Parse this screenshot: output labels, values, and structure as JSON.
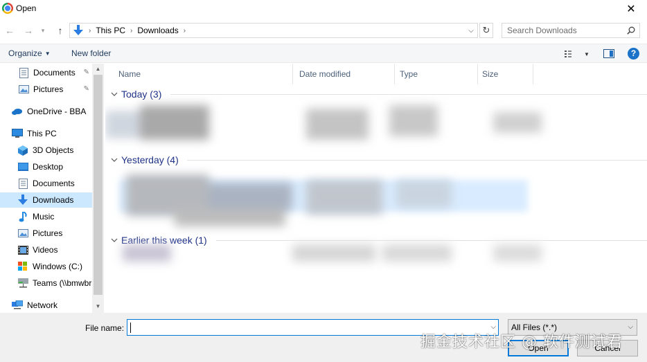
{
  "window": {
    "title": "Open",
    "close_glyph": "✕"
  },
  "nav": {
    "back_glyph": "←",
    "forward_glyph": "→",
    "recent_glyph": "▾",
    "up_glyph": "↑",
    "refresh_glyph": "↻"
  },
  "address": {
    "crumbs": [
      "This PC",
      "Downloads"
    ],
    "separator": "›",
    "dropdown_glyph": "⌵"
  },
  "search": {
    "placeholder": "Search Downloads",
    "value": ""
  },
  "toolbar": {
    "organize_label": "Organize",
    "new_folder_label": "New folder",
    "help_label": "?"
  },
  "navigation_pane": {
    "items": [
      {
        "label": "Documents",
        "icon": "documents-icon",
        "pinned": true
      },
      {
        "label": "Pictures",
        "icon": "pictures-icon",
        "pinned": true
      },
      {
        "label": "OneDrive - BBA",
        "icon": "onedrive-icon"
      },
      {
        "label": "This PC",
        "icon": "this-pc-icon"
      },
      {
        "label": "3D Objects",
        "icon": "3d-objects-icon"
      },
      {
        "label": "Desktop",
        "icon": "desktop-icon"
      },
      {
        "label": "Documents",
        "icon": "documents-icon"
      },
      {
        "label": "Downloads",
        "icon": "downloads-icon",
        "selected": true
      },
      {
        "label": "Music",
        "icon": "music-icon"
      },
      {
        "label": "Pictures",
        "icon": "pictures-icon"
      },
      {
        "label": "Videos",
        "icon": "videos-icon"
      },
      {
        "label": "Windows (C:)",
        "icon": "drive-icon"
      },
      {
        "label": "Teams (\\\\bmwbr",
        "icon": "network-drive-icon"
      },
      {
        "label": "Network",
        "icon": "network-icon"
      }
    ],
    "pin_glyph": "📌"
  },
  "file_list": {
    "columns": [
      "Name",
      "Date modified",
      "Type",
      "Size"
    ],
    "groups": [
      {
        "label": "Today (3)"
      },
      {
        "label": "Yesterday (4)"
      },
      {
        "label": "Earlier this week (1)"
      }
    ]
  },
  "footer": {
    "file_name_label": "File name:",
    "file_name_value": "",
    "file_type_value": "All Files (*.*)",
    "open_label": "Open",
    "cancel_label": "Cancel",
    "dropdown_glyph": "⌵"
  },
  "watermark": "掘金技术社区 @ 软件测试君",
  "colors": {
    "accent": "#0078d7",
    "group_header": "#1e3287",
    "selection": "#cce8ff",
    "toolbar_bg": "#f5f6f7",
    "footer_bg": "#f0f0f0"
  }
}
